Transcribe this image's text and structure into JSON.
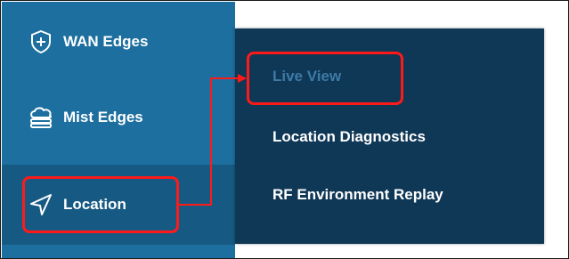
{
  "sidebar": {
    "items": [
      {
        "label": "WAN Edges",
        "icon": "plus-shield-icon"
      },
      {
        "label": "Mist Edges",
        "icon": "cloud-stack-icon"
      },
      {
        "label": "Location",
        "icon": "navigation-arrow-icon"
      }
    ]
  },
  "flyout": {
    "items": [
      {
        "label": "Live View"
      },
      {
        "label": "Location Diagnostics"
      },
      {
        "label": "RF Environment Replay"
      }
    ]
  },
  "colors": {
    "sidebar_bg": "#1d6f9f",
    "sidebar_active_bg": "#165a83",
    "flyout_bg": "#0f3756",
    "flyout_hover_text": "#3d7aa6",
    "highlight": "#ff1a1a"
  }
}
